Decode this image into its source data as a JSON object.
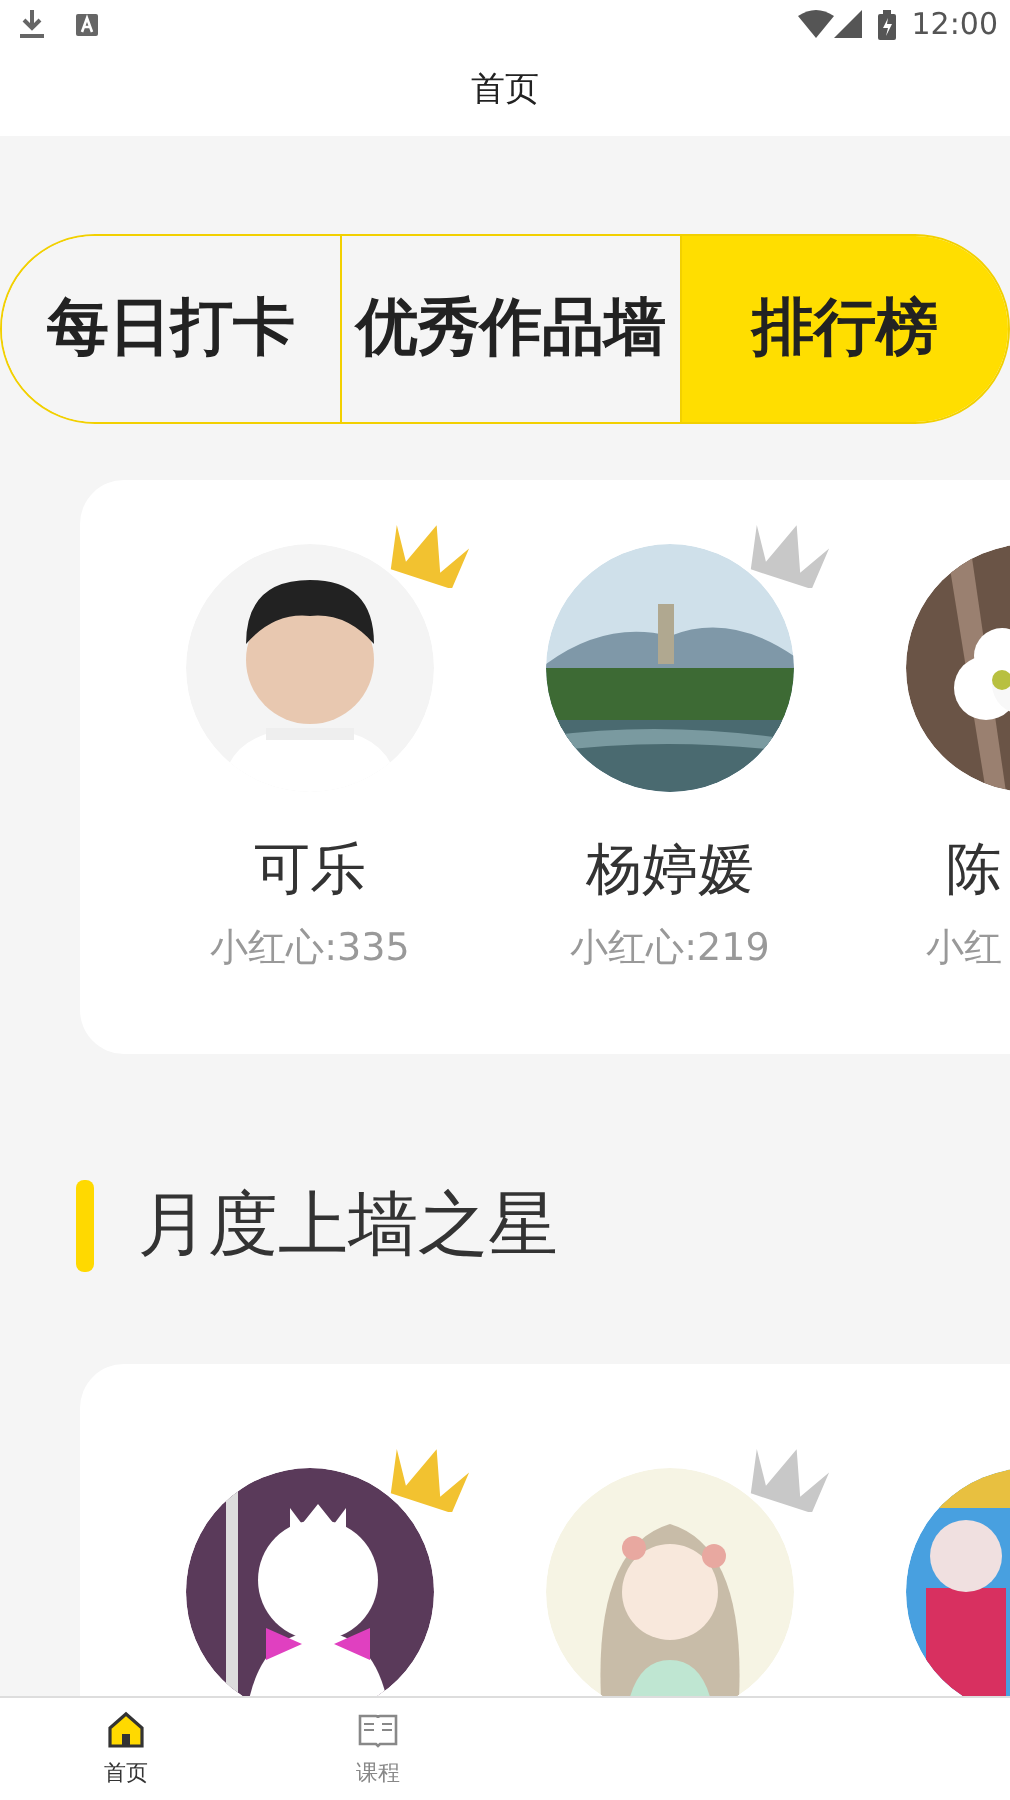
{
  "status_bar": {
    "time": "12:00"
  },
  "header": {
    "title": "首页"
  },
  "tabs": [
    {
      "label": "每日打卡",
      "selected": false
    },
    {
      "label": "优秀作品墙",
      "selected": false
    },
    {
      "label": "排行榜",
      "selected": true
    }
  ],
  "leaderboard": {
    "entries": [
      {
        "avatar": {
          "kind": "picture"
        },
        "name": "可乐",
        "score": "小红心:335",
        "color": "#f2c230"
      },
      {
        "avatar": {
          "kind": "picture"
        },
        "name": "杨婷媛",
        "score": "小红心:219",
        "color": "#c8c8c8"
      },
      {
        "avatar": {
          "kind": "picture"
        },
        "name": "陈",
        "score": "小红"
      }
    ]
  },
  "monthly_stars": {
    "title": "月度上墙之星",
    "entries": [
      {
        "avatar": {
          "kind": "picture"
        },
        "color": "#f2c230"
      },
      {
        "avatar": {
          "kind": "picture"
        },
        "color": "#c8c8c8"
      },
      {
        "avatar": {
          "kind": "picture"
        }
      }
    ]
  },
  "bottom_nav": [
    {
      "label": "首页",
      "selected": true
    },
    {
      "label": "课程",
      "selected": false
    }
  ]
}
